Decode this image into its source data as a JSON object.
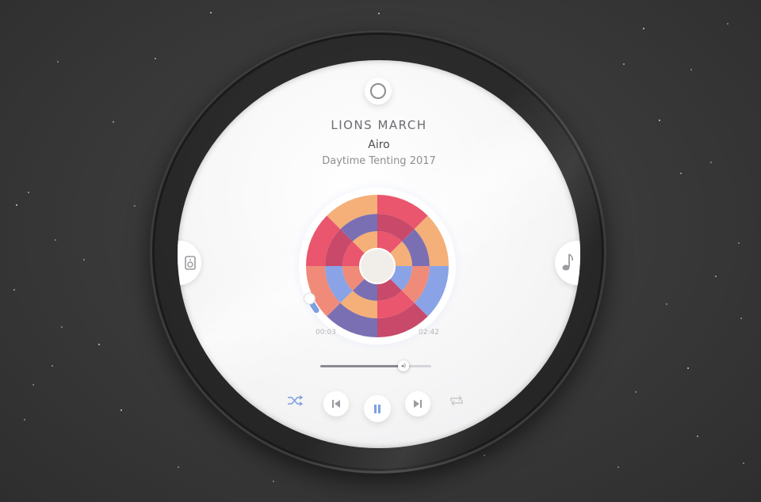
{
  "track": {
    "title": "LIONS MARCH",
    "artist": "Airo",
    "album": "Daytime Tenting 2017"
  },
  "playback": {
    "elapsed": "00:03",
    "total": "02:42",
    "progress": 0.02,
    "volume": 0.75,
    "state": "playing"
  },
  "controls": {
    "shuffle_icon": "shuffle-icon",
    "previous_icon": "skip-previous-icon",
    "pause_icon": "pause-icon",
    "next_icon": "skip-next-icon",
    "repeat_icon": "repeat-icon",
    "top_icon": "ring-icon",
    "left_icon": "speaker-icon",
    "right_icon": "music-note-icon",
    "volume_icon": "volume-icon"
  },
  "colors": {
    "accent": "#7ea0e0",
    "disc": [
      "#e9566d",
      "#f4b078",
      "#8aa3e6",
      "#c8496a",
      "#7a6fb3",
      "#f08b7a"
    ]
  }
}
